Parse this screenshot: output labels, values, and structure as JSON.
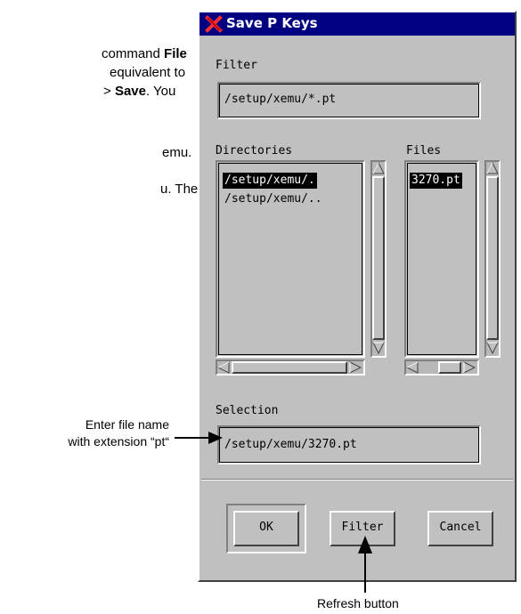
{
  "background_doc": {
    "line1_a": "command ",
    "line1_b": "File",
    "line2": "equivalent to",
    "line3_a": "> ",
    "line3_b": "Save",
    "line3_c": ". You",
    "line4": "emu.",
    "line5": "u. The path"
  },
  "dialog": {
    "title": "Save P Keys",
    "filter_label": "Filter",
    "filter_value": "/setup/xemu/*.pt",
    "directories_label": "Directories",
    "directories": [
      "/setup/xemu/.",
      "/setup/xemu/.."
    ],
    "files_label": "Files",
    "files": [
      "3270.pt"
    ],
    "selection_label": "Selection",
    "selection_value": "/setup/xemu/3270.pt",
    "buttons": {
      "ok": "OK",
      "filter": "Filter",
      "cancel": "Cancel"
    }
  },
  "annotations": {
    "enter_file_line1": "Enter file name",
    "enter_file_line2": "with extension “pt“",
    "refresh": "Refresh button"
  }
}
